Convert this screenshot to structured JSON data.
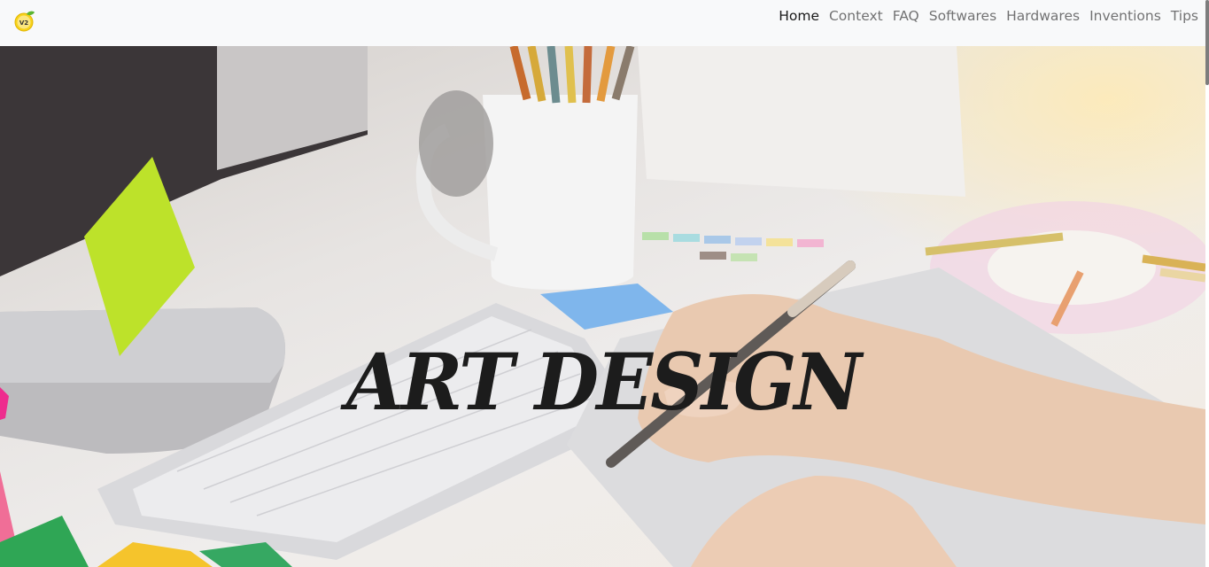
{
  "brand": {
    "logo_text": "V2",
    "logo_icon": "lemon-logo-icon"
  },
  "nav": {
    "items": [
      {
        "label": "Home",
        "active": true
      },
      {
        "label": "Context",
        "active": false
      },
      {
        "label": "FAQ",
        "active": false
      },
      {
        "label": "Softwares",
        "active": false
      },
      {
        "label": "Hardwares",
        "active": false
      },
      {
        "label": "Inventions",
        "active": false
      },
      {
        "label": "Tips",
        "active": false
      }
    ]
  },
  "hero": {
    "title": "ART DESIGN",
    "image": "designer-desk-photo"
  },
  "colors": {
    "navbar_bg": "#f8f9fa",
    "title_color": "#1c1c1c",
    "active_link": "#1a1a1a",
    "link": "#6c6c6c"
  }
}
